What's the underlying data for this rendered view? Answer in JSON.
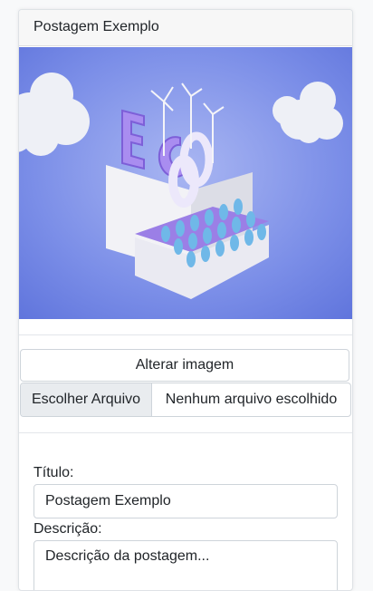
{
  "card": {
    "title": "Postagem Exemplo"
  },
  "image": {
    "subject": "eco-city-3d-illustration",
    "letters": [
      "E",
      "C",
      "O"
    ]
  },
  "actions": {
    "change_image_label": "Alterar imagem"
  },
  "file_input": {
    "button_label": "Escolher Arquivo",
    "status_text": "Nenhum arquivo escolhido"
  },
  "form": {
    "title_label": "Título:",
    "title_value": "Postagem Exemplo",
    "description_label": "Descrição:",
    "description_value": "Descrição da postagem..."
  },
  "colors": {
    "image_background": "#6f83e6",
    "accent_purple": "#8a6be0",
    "block_white": "#f2f2f6",
    "tree_blue": "#6fb8e8"
  }
}
